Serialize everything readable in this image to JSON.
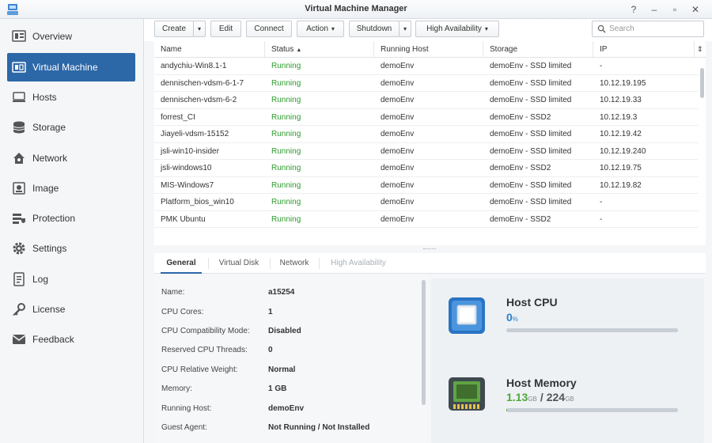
{
  "window": {
    "title": "Virtual Machine Manager",
    "controls": [
      "?",
      "–",
      "▫",
      "✕"
    ]
  },
  "sidebar": {
    "items": [
      {
        "label": "Overview",
        "icon": "overview-icon"
      },
      {
        "label": "Virtual Machine",
        "icon": "virtual-machine-icon",
        "active": true
      },
      {
        "label": "Hosts",
        "icon": "hosts-icon"
      },
      {
        "label": "Storage",
        "icon": "storage-icon"
      },
      {
        "label": "Network",
        "icon": "network-icon"
      },
      {
        "label": "Image",
        "icon": "image-icon"
      },
      {
        "label": "Protection",
        "icon": "protection-icon"
      },
      {
        "label": "Settings",
        "icon": "settings-icon"
      },
      {
        "label": "Log",
        "icon": "log-icon"
      },
      {
        "label": "License",
        "icon": "license-icon"
      },
      {
        "label": "Feedback",
        "icon": "feedback-icon"
      }
    ]
  },
  "toolbar": {
    "create": "Create",
    "edit": "Edit",
    "connect": "Connect",
    "action": "Action",
    "shutdown": "Shutdown",
    "high_availability": "High Availability",
    "search_placeholder": "Search"
  },
  "table": {
    "columns": [
      "Name",
      "Status",
      "Running Host",
      "Storage",
      "IP"
    ],
    "rows": [
      [
        "andychiu-Win8.1-1",
        "Running",
        "demoEnv",
        "demoEnv - SSD limited",
        "-"
      ],
      [
        "dennischen-vdsm-6-1-7",
        "Running",
        "demoEnv",
        "demoEnv - SSD limited",
        "10.12.19.195"
      ],
      [
        "dennischen-vdsm-6-2",
        "Running",
        "demoEnv",
        "demoEnv - SSD limited",
        "10.12.19.33"
      ],
      [
        "forrest_CI",
        "Running",
        "demoEnv",
        "demoEnv - SSD2",
        "10.12.19.3"
      ],
      [
        "Jiayeli-vdsm-15152",
        "Running",
        "demoEnv",
        "demoEnv - SSD limited",
        "10.12.19.42"
      ],
      [
        "jsli-win10-insider",
        "Running",
        "demoEnv",
        "demoEnv - SSD limited",
        "10.12.19.240"
      ],
      [
        "jsli-windows10",
        "Running",
        "demoEnv",
        "demoEnv - SSD2",
        "10.12.19.75"
      ],
      [
        "MIS-Windows7",
        "Running",
        "demoEnv",
        "demoEnv - SSD limited",
        "10.12.19.82"
      ],
      [
        "Platform_bios_win10",
        "Running",
        "demoEnv",
        "demoEnv - SSD limited",
        "-"
      ],
      [
        "PMK Ubuntu",
        "Running",
        "demoEnv",
        "demoEnv - SSD2",
        "-"
      ]
    ]
  },
  "tabs": {
    "general": "General",
    "virtual_disk": "Virtual Disk",
    "network": "Network",
    "high_availability": "High Availability"
  },
  "details": [
    {
      "label": "Name:",
      "value": "a15254"
    },
    {
      "label": "CPU Cores:",
      "value": "1"
    },
    {
      "label": "CPU Compatibility Mode:",
      "value": "Disabled"
    },
    {
      "label": "Reserved CPU Threads:",
      "value": "0"
    },
    {
      "label": "CPU Relative Weight:",
      "value": "Normal"
    },
    {
      "label": "Memory:",
      "value": "1 GB"
    },
    {
      "label": "Running Host:",
      "value": "demoEnv"
    },
    {
      "label": "Guest Agent:",
      "value": "Not Running / Not Installed"
    }
  ],
  "host": {
    "cpu": {
      "title": "Host CPU",
      "value": "0",
      "unit": "%",
      "usage_fraction": 0.0
    },
    "memory": {
      "title": "Host Memory",
      "used": "1.13",
      "used_unit": "GB",
      "separator": "/",
      "total": "224",
      "total_unit": "GB",
      "usage_fraction": 0.005
    }
  },
  "colors": {
    "accent": "#2c67a8",
    "running": "#2e9b2e",
    "memory_used": "#4ea83a"
  }
}
